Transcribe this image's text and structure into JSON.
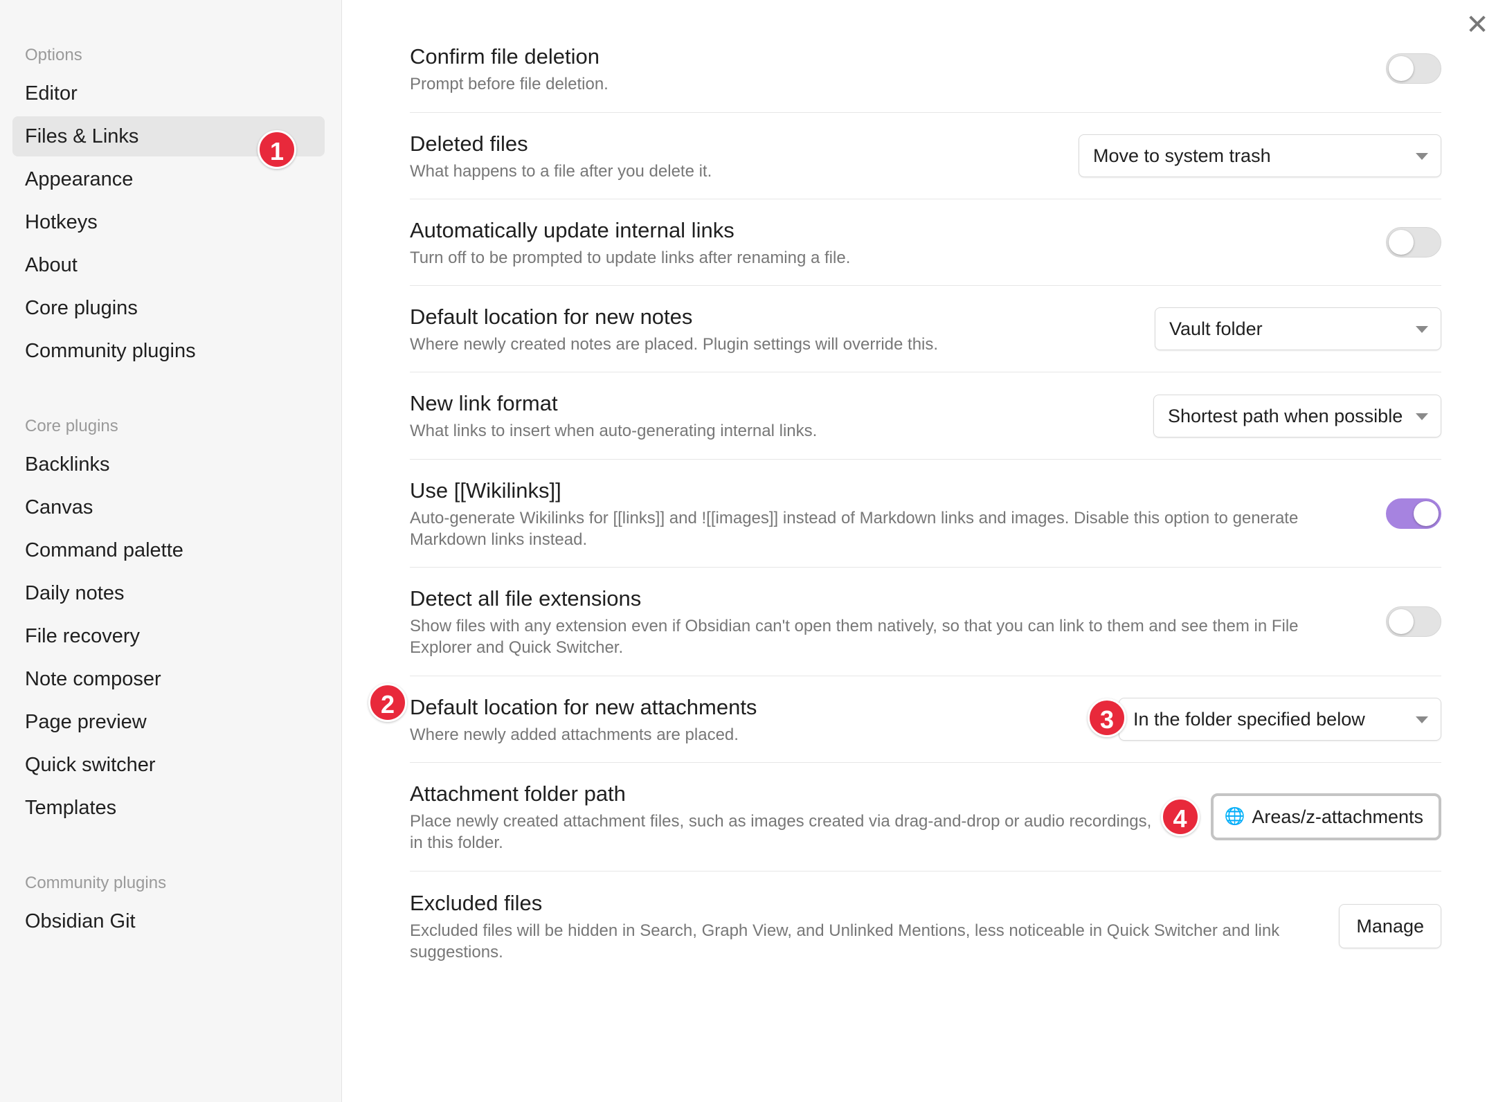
{
  "close_icon": "✕",
  "sidebar": {
    "groups": [
      {
        "heading": "Options",
        "items": [
          "Editor",
          "Files & Links",
          "Appearance",
          "Hotkeys",
          "About",
          "Core plugins",
          "Community plugins"
        ]
      },
      {
        "heading": "Core plugins",
        "items": [
          "Backlinks",
          "Canvas",
          "Command palette",
          "Daily notes",
          "File recovery",
          "Note composer",
          "Page preview",
          "Quick switcher",
          "Templates"
        ]
      },
      {
        "heading": "Community plugins",
        "items": [
          "Obsidian Git"
        ]
      }
    ],
    "active_item": "Files & Links"
  },
  "markers": [
    "1",
    "2",
    "3",
    "4"
  ],
  "settings": {
    "confirm_deletion": {
      "title": "Confirm file deletion",
      "desc": "Prompt before file deletion.",
      "enabled": false
    },
    "deleted_files": {
      "title": "Deleted files",
      "desc": "What happens to a file after you delete it.",
      "value": "Move to system trash"
    },
    "auto_update_links": {
      "title": "Automatically update internal links",
      "desc": "Turn off to be prompted to update links after renaming a file.",
      "enabled": false
    },
    "default_location_notes": {
      "title": "Default location for new notes",
      "desc": "Where newly created notes are placed. Plugin settings will override this.",
      "value": "Vault folder"
    },
    "new_link_format": {
      "title": "New link format",
      "desc": "What links to insert when auto-generating internal links.",
      "value": "Shortest path when possible"
    },
    "use_wikilinks": {
      "title": "Use [[Wikilinks]]",
      "desc": "Auto-generate Wikilinks for [[links]] and ![[images]] instead of Markdown links and images. Disable this option to generate Markdown links instead.",
      "enabled": true
    },
    "detect_extensions": {
      "title": "Detect all file extensions",
      "desc": "Show files with any extension even if Obsidian can't open them natively, so that you can link to them and see them in File Explorer and Quick Switcher.",
      "enabled": false
    },
    "default_location_attachments": {
      "title": "Default location for new attachments",
      "desc": "Where newly added attachments are placed.",
      "value": "In the folder specified below"
    },
    "attachment_folder_path": {
      "title": "Attachment folder path",
      "desc": "Place newly created attachment files, such as images created via drag-and-drop or audio recordings, in this folder.",
      "value": "Areas/z-attachments"
    },
    "excluded_files": {
      "title": "Excluded files",
      "desc": "Excluded files will be hidden in Search, Graph View, and Unlinked Mentions, less noticeable in Quick Switcher and link suggestions.",
      "button_label": "Manage"
    }
  },
  "colors": {
    "toggle_on": "#a683e0",
    "marker": "#e8293b"
  }
}
